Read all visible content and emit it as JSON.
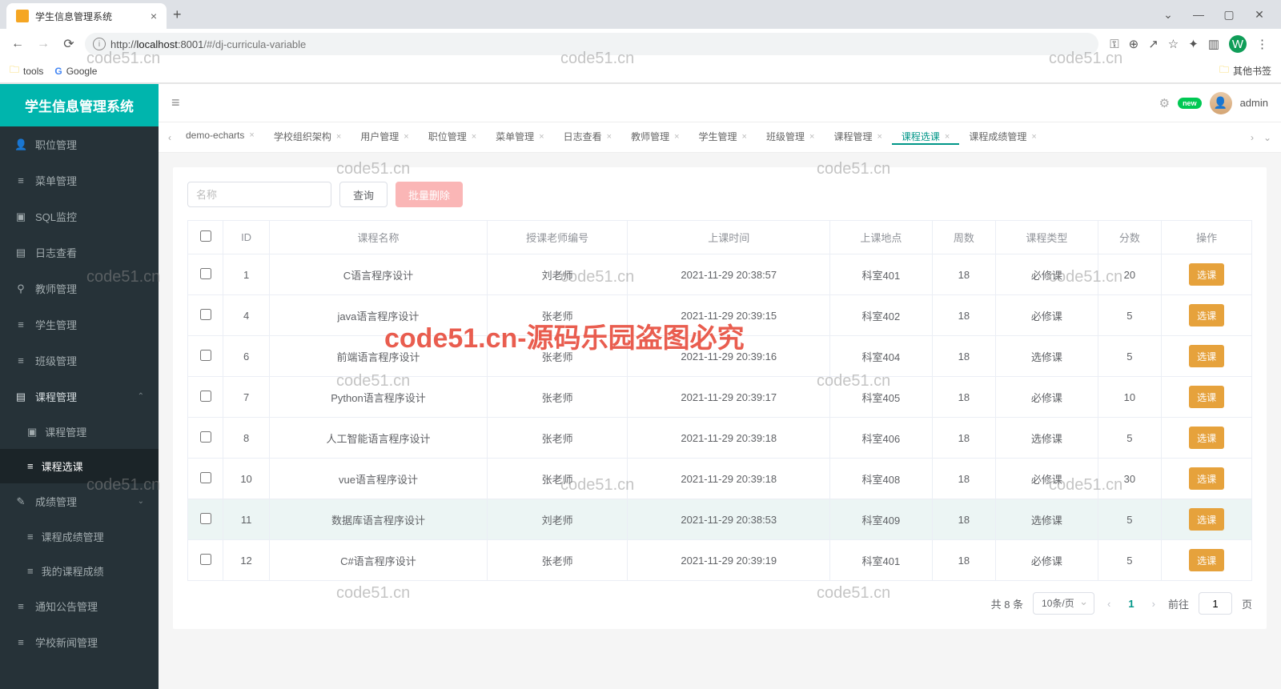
{
  "browser": {
    "tab_title": "学生信息管理系统",
    "url_host": "localhost",
    "url_port": ":8001",
    "url_path": "/#/dj-curricula-variable",
    "url_scheme": "http://",
    "bookmarks": {
      "tools": "tools",
      "google": "Google",
      "other": "其他书签"
    },
    "avatar_letter": "W"
  },
  "app": {
    "title": "学生信息管理系统",
    "username": "admin",
    "new_badge": "new"
  },
  "sidebar": {
    "items": [
      {
        "icon": "👤",
        "label": "职位管理"
      },
      {
        "icon": "≡",
        "label": "菜单管理"
      },
      {
        "icon": "▣",
        "label": "SQL监控"
      },
      {
        "icon": "▤",
        "label": "日志查看"
      },
      {
        "icon": "⚲",
        "label": "教师管理"
      },
      {
        "icon": "≡",
        "label": "学生管理"
      },
      {
        "icon": "≡",
        "label": "班级管理"
      },
      {
        "icon": "▤",
        "label": "课程管理"
      },
      {
        "icon": "✎",
        "label": "成绩管理"
      },
      {
        "icon": "≡",
        "label": "通知公告管理"
      },
      {
        "icon": "≡",
        "label": "学校新闻管理"
      }
    ],
    "course_sub": [
      {
        "icon": "▣",
        "label": "课程管理"
      },
      {
        "icon": "≡",
        "label": "课程选课"
      }
    ],
    "grade_sub": [
      {
        "icon": "≡",
        "label": "课程成绩管理"
      },
      {
        "icon": "≡",
        "label": "我的课程成绩"
      }
    ]
  },
  "tabs": [
    {
      "label": "demo-echarts",
      "active": false
    },
    {
      "label": "学校组织架构",
      "active": false
    },
    {
      "label": "用户管理",
      "active": false
    },
    {
      "label": "职位管理",
      "active": false
    },
    {
      "label": "菜单管理",
      "active": false
    },
    {
      "label": "日志查看",
      "active": false
    },
    {
      "label": "教师管理",
      "active": false
    },
    {
      "label": "学生管理",
      "active": false
    },
    {
      "label": "班级管理",
      "active": false
    },
    {
      "label": "课程管理",
      "active": false
    },
    {
      "label": "课程选课",
      "active": true
    },
    {
      "label": "课程成绩管理",
      "active": false
    }
  ],
  "toolbar": {
    "search_placeholder": "名称",
    "query_btn": "查询",
    "batch_delete_btn": "批量删除"
  },
  "table": {
    "headers": [
      "",
      "ID",
      "课程名称",
      "授课老师编号",
      "上课时间",
      "上课地点",
      "周数",
      "课程类型",
      "分数",
      "操作"
    ],
    "action_label": "选课",
    "rows": [
      {
        "id": "1",
        "name": "C语言程序设计",
        "teacher": "刘老师",
        "time": "2021-11-29 20:38:57",
        "place": "科室401",
        "weeks": "18",
        "type": "必修课",
        "score": "20"
      },
      {
        "id": "4",
        "name": "java语言程序设计",
        "teacher": "张老师",
        "time": "2021-11-29 20:39:15",
        "place": "科室402",
        "weeks": "18",
        "type": "必修课",
        "score": "5"
      },
      {
        "id": "6",
        "name": "前端语言程序设计",
        "teacher": "张老师",
        "time": "2021-11-29 20:39:16",
        "place": "科室404",
        "weeks": "18",
        "type": "选修课",
        "score": "5"
      },
      {
        "id": "7",
        "name": "Python语言程序设计",
        "teacher": "张老师",
        "time": "2021-11-29 20:39:17",
        "place": "科室405",
        "weeks": "18",
        "type": "必修课",
        "score": "10"
      },
      {
        "id": "8",
        "name": "人工智能语言程序设计",
        "teacher": "张老师",
        "time": "2021-11-29 20:39:18",
        "place": "科室406",
        "weeks": "18",
        "type": "选修课",
        "score": "5"
      },
      {
        "id": "10",
        "name": "vue语言程序设计",
        "teacher": "张老师",
        "time": "2021-11-29 20:39:18",
        "place": "科室408",
        "weeks": "18",
        "type": "必修课",
        "score": "30"
      },
      {
        "id": "11",
        "name": "数据库语言程序设计",
        "teacher": "刘老师",
        "time": "2021-11-29 20:38:53",
        "place": "科室409",
        "weeks": "18",
        "type": "选修课",
        "score": "5",
        "hover": true
      },
      {
        "id": "12",
        "name": "C#语言程序设计",
        "teacher": "张老师",
        "time": "2021-11-29 20:39:19",
        "place": "科室401",
        "weeks": "18",
        "type": "必修课",
        "score": "5"
      }
    ]
  },
  "pagination": {
    "total_text": "共 8 条",
    "page_size_label": "10条/页",
    "current_page": "1",
    "goto_prefix": "前往",
    "goto_suffix": "页",
    "goto_value": "1"
  },
  "watermarks": {
    "small": "code51.cn",
    "big": "code51.cn-源码乐园盗图必究"
  }
}
